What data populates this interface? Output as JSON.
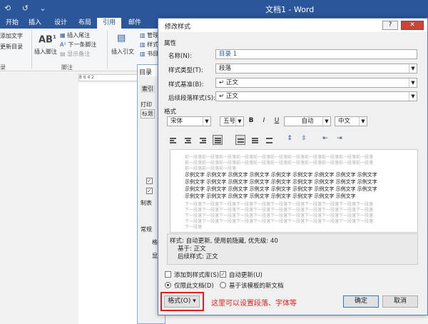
{
  "word": {
    "title": "文档1 - Word",
    "tabs": [
      "开始",
      "插入",
      "设计",
      "布局",
      "引用",
      "邮件"
    ],
    "active_tab": "引用",
    "ribbon": {
      "add_text": "添加文字",
      "update_toc": "更新目录",
      "insert_footnote": "插入脚注",
      "ab_icon": "AB",
      "superscript": "1",
      "insert_endnote": "插入尾注",
      "next_footnote": "下一条脚注",
      "show_notes": "显示备注",
      "group_toc": "录",
      "group_footnote": "脚注",
      "insert_citation": "插入引文",
      "manage": "管理",
      "style": "样式",
      "bib": "书目"
    },
    "ruler_marks": "8  6  4  2"
  },
  "toc_dialog": {
    "title": "目录",
    "tab": "索引",
    "print_preview": "打印",
    "heading": "标题",
    "formats_label": "制表",
    "general": "常规",
    "format_lbl": "格式",
    "show_lbl": "显"
  },
  "dialog": {
    "title": "修改样式",
    "help": "?",
    "close": "✕",
    "properties_section": "属性",
    "name_label": "名称(N):",
    "name_value": "目录 1",
    "type_label": "样式类型(T):",
    "type_value": "段落",
    "based_label": "样式基准(B):",
    "based_value": "↵ 正文",
    "next_label": "后续段落样式(S):",
    "next_value": "↵ 正文",
    "format_section": "格式",
    "font": "宋体",
    "size": "五号",
    "bold": "B",
    "italic": "I",
    "underline": "U",
    "color": "自动",
    "lang": "中文",
    "preview_prev": [
      "前一段落前一段落前一段落前一段落前一段落前一段落前一段落前一段落前一段落前一段落前一段落",
      "前一段落前一段落前一段落前一段落前一段落前一段落前一段落前一段落前一段落前一段落前一段落",
      "前一段落前一段落前一段落"
    ],
    "preview_sample": [
      "示例文字 示例文字 示例文字 示例文字 示例文字 示例文字 示例文字 示例文字 示例文字",
      "示例文字 示例文字 示例文字 示例文字 示例文字 示例文字 示例文字 示例文字 示例文字",
      "示例文字 示例文字 示例文字 示例文字 示例文字 示例文字 示例文字 示例文字 示例文字",
      "示例文字 示例文字 示例文字 示例文字 示例文字 示例文字 示例文字 示例文字"
    ],
    "preview_next": [
      "下一段落下一段落下一段落下一段落下一段落下一段落下一段落下一段落下一段落下一段落下一段落",
      "下一段落下一段落下一段落下一段落下一段落下一段落下一段落下一段落下一段落下一段落下一段落",
      "下一段落下一段落下一段落下一段落下一段落下一段落下一段落下一段落下一段落下一段落下一段落",
      "下一段落下一段落下一段落下一段落下一段落下一段落下一段落下一段落下一段落下一段落下一段落",
      "下一段落"
    ],
    "desc_line1": "样式: 自动更新, 使用前隐藏, 优先级: 40",
    "desc_line2": "基于: 正文",
    "desc_line3": "后续样式: 正文",
    "add_to_gallery": "添加到样式库(S)",
    "auto_update": "自动更新(U)",
    "only_this_doc": "仅限此文档(D)",
    "new_docs": "基于该模板的新文档",
    "format_button": "格式(O) ▾",
    "annotation": "这里可以设置段落、字体等",
    "ok": "确定",
    "cancel": "取消"
  },
  "colors": {
    "word_blue": "#2b579a",
    "annotation_red": "#e02020",
    "dialog_border": "#5b7fb9"
  }
}
